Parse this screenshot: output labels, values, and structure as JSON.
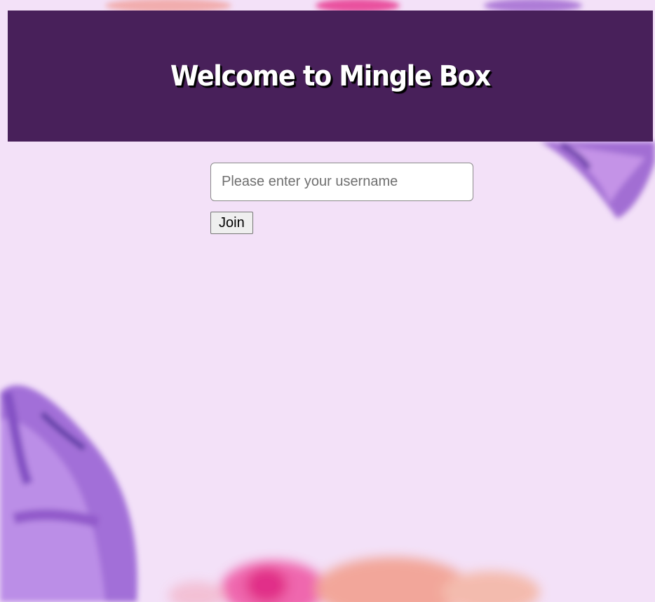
{
  "header": {
    "title": "Welcome to Mingle Box"
  },
  "login_form": {
    "username_value": "",
    "username_placeholder": "Please enter your username",
    "join_label": "Join"
  },
  "colors": {
    "page_background": "#f3e1f8",
    "header_background": "#48205a",
    "title_text": "#ffffff"
  },
  "decorations": {
    "background_art": "watercolor-flowers-image"
  }
}
